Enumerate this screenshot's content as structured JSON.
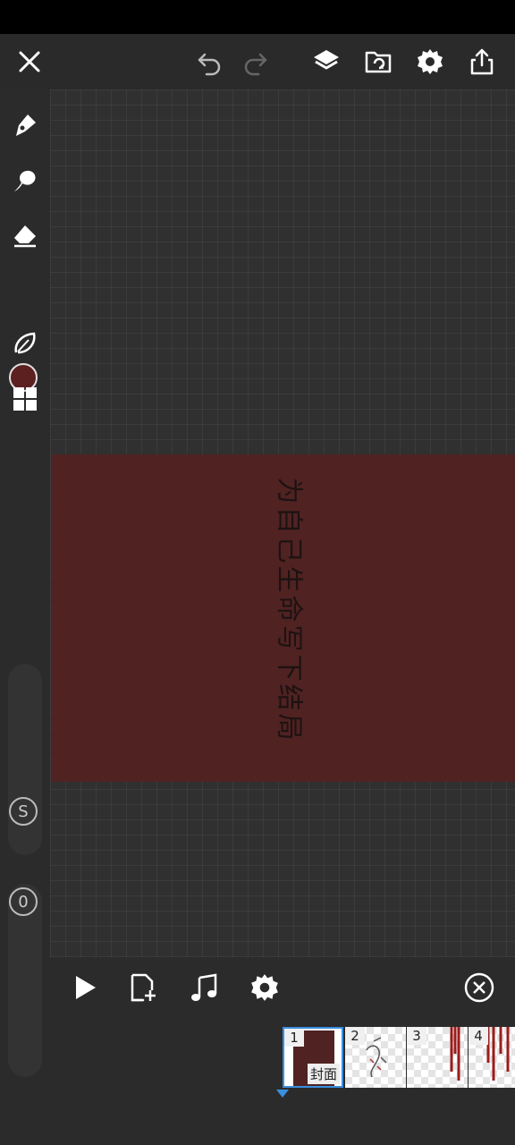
{
  "artwork": {
    "title_text": "为自己生命写下结局",
    "background_color": "#502222"
  },
  "toolbar": {
    "icons": [
      "close-icon",
      "undo-icon",
      "redo-icon",
      "layers-icon",
      "import-icon",
      "settings-icon",
      "share-icon"
    ]
  },
  "tools": {
    "icons": [
      "pen-icon",
      "smudge-icon",
      "eraser-icon",
      "color-swatch",
      "lasso-icon",
      "grid-menu-icon"
    ],
    "current_color": "#5c2020",
    "size_slider_label": "S",
    "opacity_slider_label": "0"
  },
  "animation": {
    "icons": [
      "play-icon",
      "add-frame-icon",
      "music-icon",
      "animation-settings-icon",
      "close-circle-icon"
    ],
    "frames": [
      {
        "number": "1",
        "label": "封面"
      },
      {
        "number": "2",
        "label": ""
      },
      {
        "number": "3",
        "label": ""
      },
      {
        "number": "4",
        "label": ""
      }
    ],
    "accent_color": "#3a8fe0"
  }
}
